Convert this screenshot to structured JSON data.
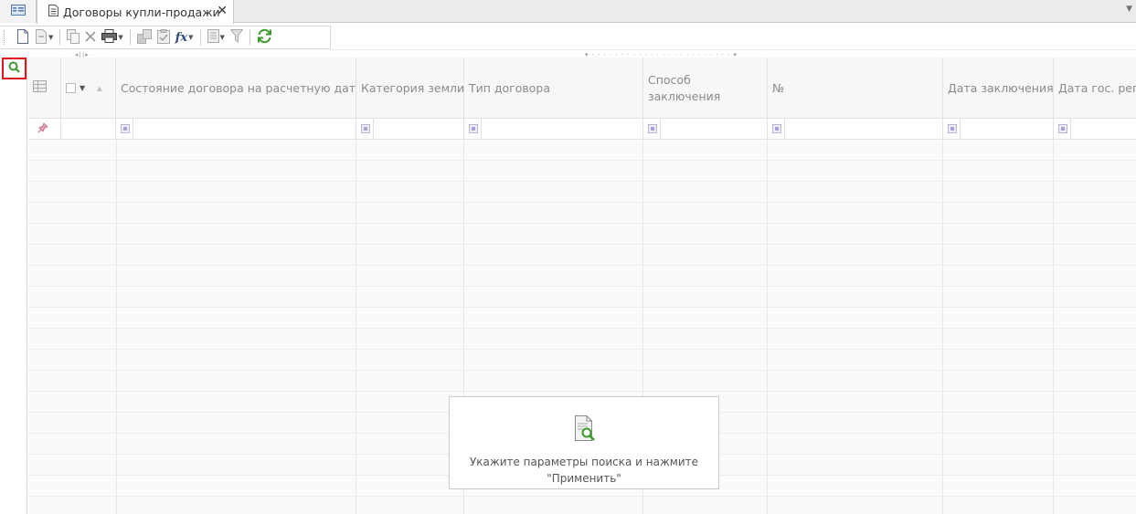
{
  "tabs": {
    "home_icon": "window-list-icon",
    "active_tab_label": "Договоры купли-продажи",
    "close_glyph": "✕",
    "menu_glyph": "▼"
  },
  "toolbar": {
    "buttons": [
      {
        "name": "new-document",
        "icon": "new-document-icon"
      },
      {
        "name": "edit",
        "icon": "edit-icon",
        "dropdown": true
      },
      {
        "name": "copy",
        "icon": "copy-icon"
      },
      {
        "name": "delete",
        "icon": "delete-icon"
      },
      {
        "name": "print",
        "icon": "printer-icon",
        "dropdown": true
      },
      {
        "name": "export",
        "icon": "export-icon"
      },
      {
        "name": "report",
        "icon": "report-icon"
      },
      {
        "name": "formula",
        "icon": "fx-icon",
        "dropdown": true
      },
      {
        "name": "view",
        "icon": "view-icon",
        "dropdown": true
      },
      {
        "name": "filter",
        "icon": "filter-icon"
      },
      {
        "name": "refresh",
        "icon": "refresh-icon"
      }
    ]
  },
  "grid": {
    "columns": [
      {
        "key": "state",
        "label": "Состояние договора на расчетную дату"
      },
      {
        "key": "land_category",
        "label": "Категория земли"
      },
      {
        "key": "contract_type",
        "label": "Тип договора"
      },
      {
        "key": "conclusion_method",
        "label": "Способ заключения"
      },
      {
        "key": "number",
        "label": "№"
      },
      {
        "key": "conclusion_date",
        "label": "Дата заключения"
      },
      {
        "key": "state_reg_date",
        "label": "Дата гос. регистрации"
      }
    ],
    "empty_rows": 18
  },
  "hint": {
    "icon": "search-document-icon",
    "line1": "Укажите параметры поиска и нажмите",
    "line2": "\"Применить\""
  }
}
